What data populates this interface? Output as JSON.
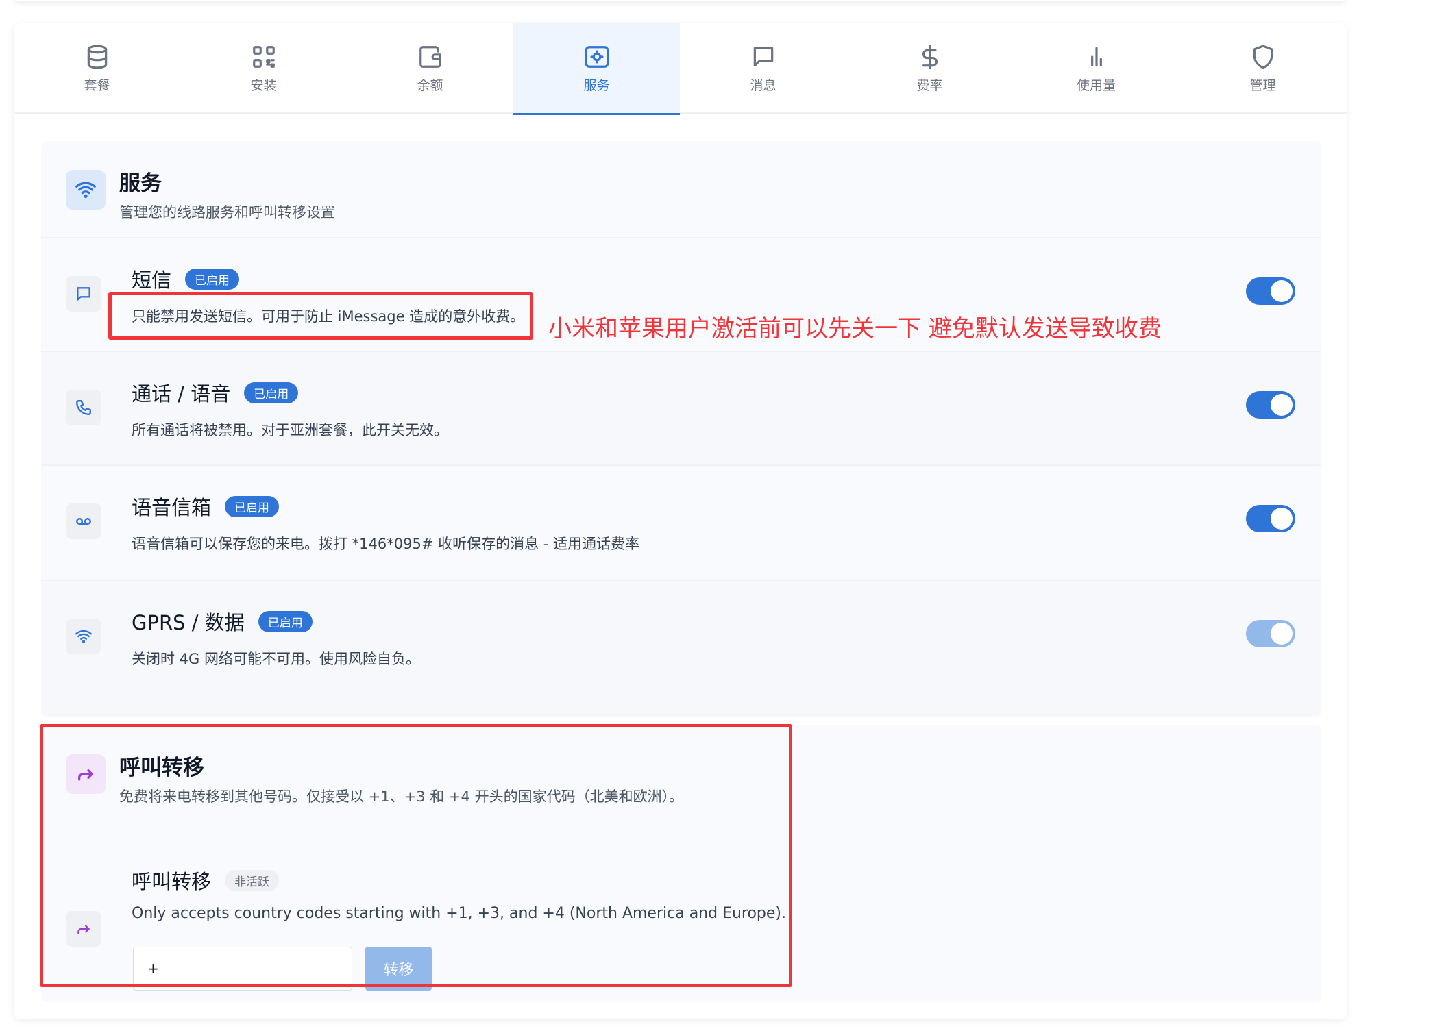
{
  "tabs": [
    {
      "label": "套餐",
      "icon": "database-icon"
    },
    {
      "label": "安装",
      "icon": "qr-code-icon"
    },
    {
      "label": "余额",
      "icon": "wallet-icon"
    },
    {
      "label": "服务",
      "icon": "service-settings-icon",
      "active": true
    },
    {
      "label": "消息",
      "icon": "message-icon"
    },
    {
      "label": "费率",
      "icon": "dollar-icon"
    },
    {
      "label": "使用量",
      "icon": "bar-chart-icon"
    },
    {
      "label": "管理",
      "icon": "shield-icon"
    }
  ],
  "services": {
    "title": "服务",
    "description": "管理您的线路服务和呼叫转移设置",
    "items": [
      {
        "title": "短信",
        "badge": "已启用",
        "description": "只能禁用发送短信。可用于防止 iMessage 造成的意外收费。",
        "enabled": true
      },
      {
        "title": "通话 / 语音",
        "badge": "已启用",
        "description": "所有通话将被禁用。对于亚洲套餐，此开关无效。",
        "enabled": true
      },
      {
        "title": "语音信箱",
        "badge": "已启用",
        "description": "语音信箱可以保存您的来电。拨打 *146*095# 收听保存的消息 - 适用通话费率",
        "enabled": true
      },
      {
        "title": "GPRS / 数据",
        "badge": "已启用",
        "description": "关闭时 4G 网络可能不可用。使用风险自负。",
        "enabled": true
      }
    ]
  },
  "annotation": "小米和苹果用户激活前可以先关一下 避免默认发送导致收费",
  "call_forwarding": {
    "title": "呼叫转移",
    "description": "免费将来电转移到其他号码。仅接受以 +1、+3 和 +4 开头的国家代码（北美和欧洲）。",
    "subtitle": "呼叫转移",
    "status_badge": "非活跃",
    "note": "Only accepts country codes starting with +1, +3, and +4 (North America and Europe).",
    "input_value": "+",
    "button_label": "转移"
  }
}
